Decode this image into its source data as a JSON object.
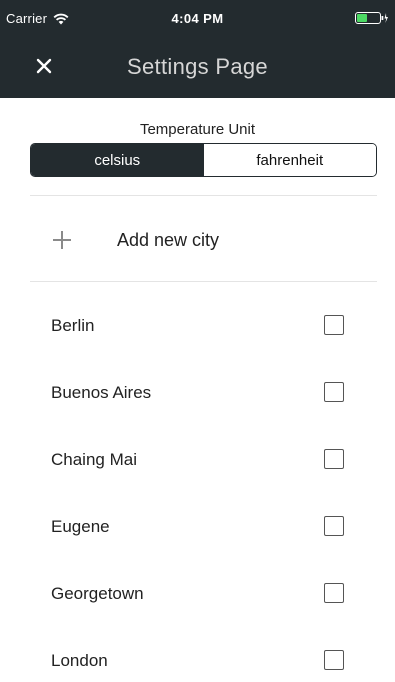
{
  "status_bar": {
    "carrier": "Carrier",
    "time": "4:04 PM",
    "icons": [
      "wifi-icon",
      "battery-icon"
    ]
  },
  "nav": {
    "title": "Settings Page",
    "close_icon": "close-icon"
  },
  "temperature": {
    "label": "Temperature Unit",
    "options": [
      "celsius",
      "fahrenheit"
    ],
    "selected": "celsius"
  },
  "add_city": {
    "label": "Add new city",
    "icon": "plus-icon"
  },
  "cities": [
    {
      "name": "Berlin",
      "checked": false
    },
    {
      "name": "Buenos Aires",
      "checked": false
    },
    {
      "name": "Chaing Mai",
      "checked": false
    },
    {
      "name": "Eugene",
      "checked": false
    },
    {
      "name": "Georgetown",
      "checked": false
    },
    {
      "name": "London",
      "checked": false
    }
  ],
  "colors": {
    "header_bg": "#232b2f",
    "title_text": "#d6d6d6",
    "battery_green": "#4cd964"
  }
}
